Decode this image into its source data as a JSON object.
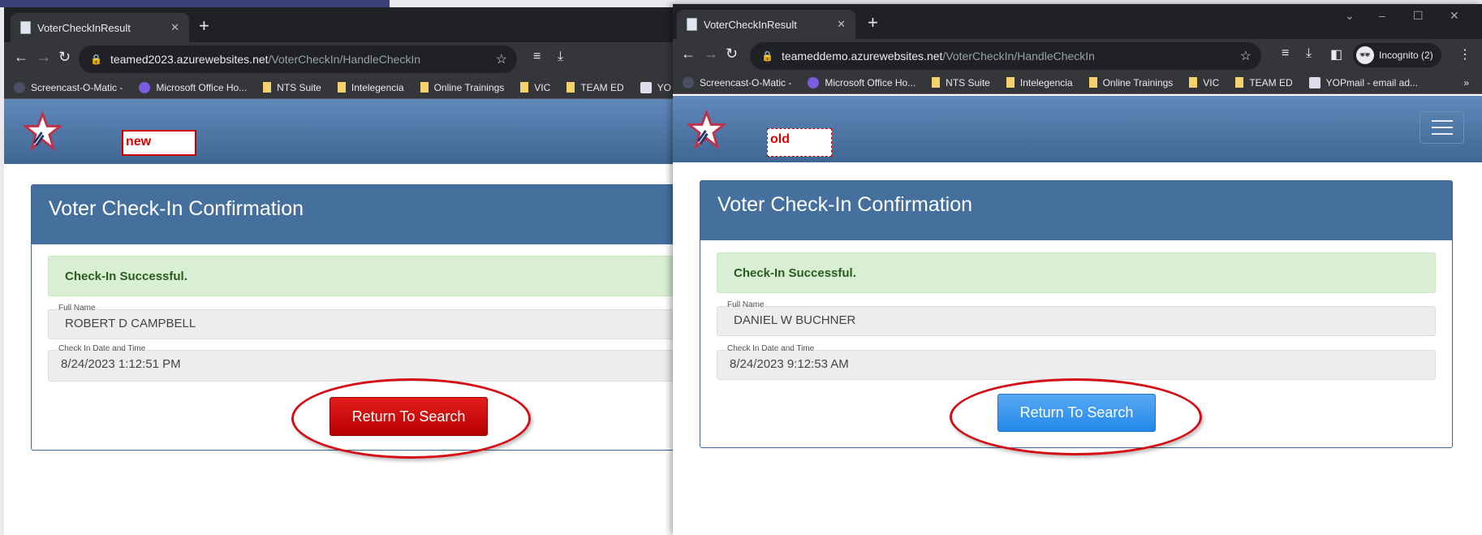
{
  "left_window": {
    "tab_title": "VoterCheckInResult",
    "url_host": "teamed2023.azurewebsites.net",
    "url_path": "/VoterCheckIn/HandleCheckIn",
    "bookmarks": [
      "Screencast-O-Matic -",
      "Microsoft Office Ho...",
      "NTS Suite",
      "Intelegencia",
      "Online Trainings",
      "VIC",
      "TEAM ED",
      "YO"
    ],
    "annotation": "new",
    "card_title": "Voter Check-In Confirmation",
    "alert": "Check-In Successful.",
    "full_name_label": "Full Name",
    "full_name": "ROBERT D CAMPBELL",
    "datetime_label": "Check In Date and Time",
    "datetime": "8/24/2023 1:12:51 PM",
    "button": "Return To Search",
    "button_color": "#c80a0a"
  },
  "right_window": {
    "tab_title": "VoterCheckInResult",
    "url_host": "teameddemo.azurewebsites.net",
    "url_path": "/VoterCheckIn/HandleCheckIn",
    "profile": "Incognito (2)",
    "bookmarks": [
      "Screencast-O-Matic -",
      "Microsoft Office Ho...",
      "NTS Suite",
      "Intelegencia",
      "Online Trainings",
      "VIC",
      "TEAM ED",
      "YOPmail - email ad..."
    ],
    "overflow": "»",
    "annotation": "old",
    "card_title": "Voter Check-In Confirmation",
    "alert": "Check-In Successful.",
    "full_name_label": "Full Name",
    "full_name": "DANIEL W BUCHNER",
    "datetime_label": "Check In Date and Time",
    "datetime": "8/24/2023 9:12:53 AM",
    "button": "Return To Search",
    "button_color": "#2a8cec"
  }
}
